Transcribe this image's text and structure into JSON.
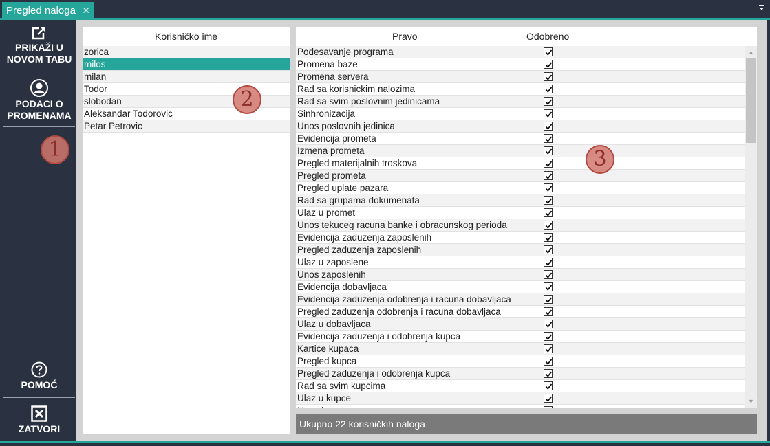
{
  "tab": {
    "title": "Pregled naloga",
    "close_glyph": "✕"
  },
  "sidebar": {
    "open_new_tab": {
      "line1": "PRIKAŽI U",
      "line2": "NOVOM TABU",
      "icon": "external-link-icon"
    },
    "change_info": {
      "line1": "PODACI O",
      "line2": "PROMENAMA",
      "icon": "user-icon"
    },
    "help": {
      "label": "POMOĆ",
      "icon": "help-icon"
    },
    "close": {
      "label": "ZATVORI",
      "icon": "close-box-icon"
    }
  },
  "markers": {
    "m1": "1",
    "m2": "2",
    "m3": "3"
  },
  "users": {
    "header": "Korisničko ime",
    "selected_index": 1,
    "rows": [
      "zorica",
      "milos",
      "milan",
      "Todor",
      "slobodan",
      "Aleksandar Todorovic",
      "Petar Petrovic"
    ]
  },
  "rights": {
    "header_right": "Pravo",
    "header_approved": "Odobreno",
    "rows": [
      {
        "name": "Podesavanje programa",
        "approved": true
      },
      {
        "name": "Promena baze",
        "approved": true
      },
      {
        "name": "Promena servera",
        "approved": true
      },
      {
        "name": "Rad sa korisnickim nalozima",
        "approved": true
      },
      {
        "name": "Rad sa svim poslovnim jedinicama",
        "approved": true
      },
      {
        "name": "Sinhronizacija",
        "approved": true
      },
      {
        "name": "Unos poslovnih jedinica",
        "approved": true
      },
      {
        "name": "Evidencija prometa",
        "approved": true
      },
      {
        "name": "Izmena prometa",
        "approved": true
      },
      {
        "name": "Pregled materijalnih troskova",
        "approved": true
      },
      {
        "name": "Pregled prometa",
        "approved": true
      },
      {
        "name": "Pregled uplate pazara",
        "approved": true
      },
      {
        "name": "Rad sa grupama dokumenata",
        "approved": true
      },
      {
        "name": "Ulaz u promet",
        "approved": true
      },
      {
        "name": "Unos tekuceg racuna banke i obracunskog perioda",
        "approved": true
      },
      {
        "name": "Evidencija zaduzenja zaposlenih",
        "approved": true
      },
      {
        "name": "Pregled zaduzenja zaposlenih",
        "approved": true
      },
      {
        "name": "Ulaz u zaposlene",
        "approved": true
      },
      {
        "name": "Unos zaposlenih",
        "approved": true
      },
      {
        "name": "Evidencija dobavljaca",
        "approved": true
      },
      {
        "name": "Evidencija zaduzenja odobrenja i racuna dobavljaca",
        "approved": true
      },
      {
        "name": "Pregled zaduzenja odobrenja i racuna dobavljaca",
        "approved": true
      },
      {
        "name": "Ulaz u dobavljaca",
        "approved": true
      },
      {
        "name": "Evidencija zaduzenja i odobrenja kupca",
        "approved": true
      },
      {
        "name": "Kartice kupaca",
        "approved": true
      },
      {
        "name": "Pregled kupca",
        "approved": true
      },
      {
        "name": "Pregled zaduzenja i odobrenja kupca",
        "approved": true
      },
      {
        "name": "Rad sa svim kupcima",
        "approved": true
      },
      {
        "name": "Ulaz u kupce",
        "approved": true
      },
      {
        "name": "Unos kupaca",
        "approved": true
      }
    ]
  },
  "footer": {
    "total": "Ukupno 22 korisničkih naloga"
  },
  "colors": {
    "accent": "#26a69a",
    "sidebar_bg": "#2a3140",
    "marker": "#d2786e"
  }
}
